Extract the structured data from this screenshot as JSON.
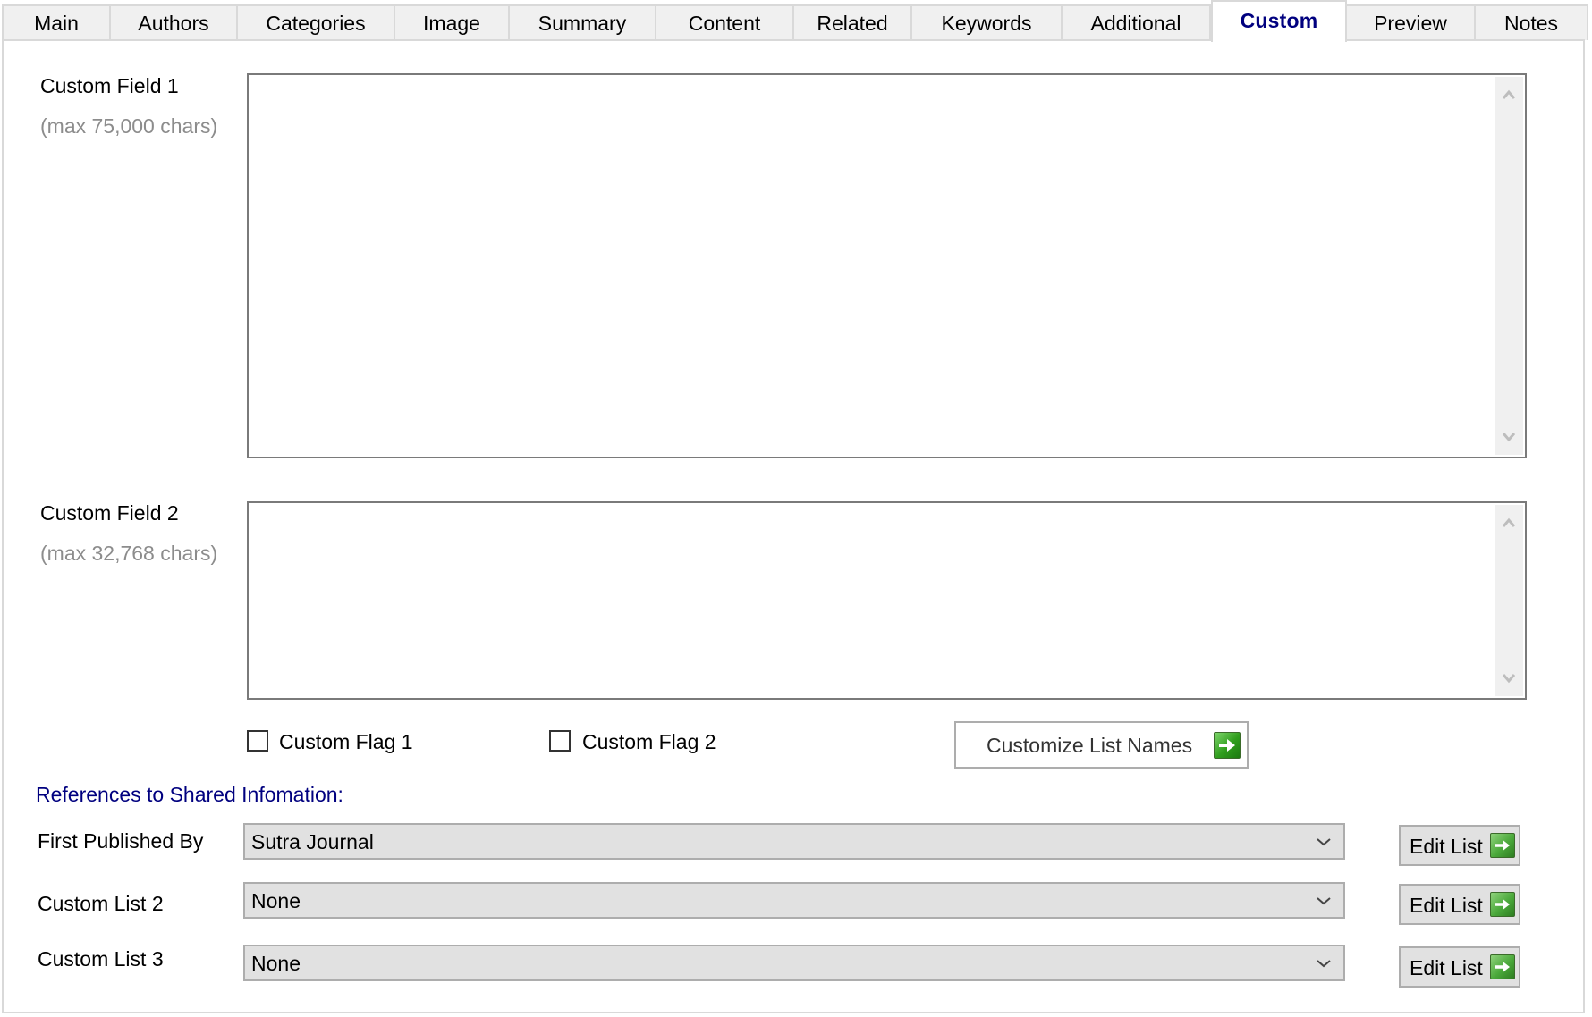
{
  "tabs": [
    {
      "label": "Main",
      "active": false
    },
    {
      "label": "Authors",
      "active": false
    },
    {
      "label": "Categories",
      "active": false
    },
    {
      "label": "Image",
      "active": false
    },
    {
      "label": "Summary",
      "active": false
    },
    {
      "label": "Content",
      "active": false
    },
    {
      "label": "Related",
      "active": false
    },
    {
      "label": "Keywords",
      "active": false
    },
    {
      "label": "Additional",
      "active": false
    },
    {
      "label": "Custom",
      "active": true
    },
    {
      "label": "Preview",
      "active": false
    },
    {
      "label": "Notes",
      "active": false
    }
  ],
  "fields": {
    "field1": {
      "label": "Custom Field 1",
      "hint": "(max 75,000 chars)",
      "value": ""
    },
    "field2": {
      "label": "Custom Field 2",
      "hint": "(max 32,768 chars)",
      "value": ""
    }
  },
  "flags": {
    "flag1": {
      "label": "Custom Flag 1",
      "checked": false
    },
    "flag2": {
      "label": "Custom Flag 2",
      "checked": false
    }
  },
  "customize_button": {
    "label": "Customize List Names",
    "icon": "green-arrow-right-icon"
  },
  "references": {
    "heading": "References to Shared Infomation:",
    "rows": [
      {
        "label": "First Published By",
        "value": "Sutra Journal",
        "button": "Edit List"
      },
      {
        "label": "Custom List 2",
        "value": "None",
        "button": "Edit List"
      },
      {
        "label": "Custom List 3",
        "value": "None",
        "button": "Edit List"
      }
    ]
  },
  "colors": {
    "active_tab_text": "#00007f",
    "section_heading": "#00007f",
    "hint_text": "#8c8c8c",
    "combo_bg": "#e1e1e1",
    "go_icon_green": "#2f9d1c"
  }
}
